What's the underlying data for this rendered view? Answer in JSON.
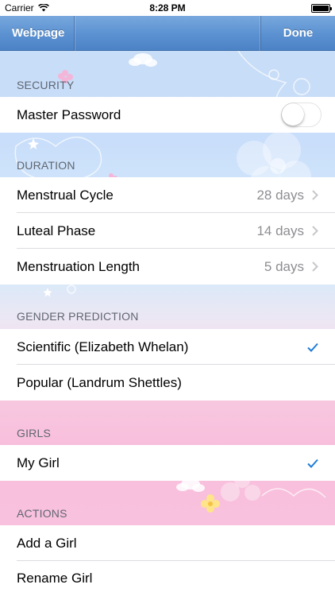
{
  "status_bar": {
    "carrier": "Carrier",
    "time": "8:28 PM"
  },
  "nav": {
    "left_label": "Webpage",
    "right_label": "Done"
  },
  "sections": {
    "security": {
      "header": "SECURITY",
      "items": [
        {
          "label": "Master Password",
          "toggle_on": false
        }
      ]
    },
    "duration": {
      "header": "DURATION",
      "items": [
        {
          "label": "Menstrual Cycle",
          "value": "28 days"
        },
        {
          "label": "Luteal Phase",
          "value": "14 days"
        },
        {
          "label": "Menstruation Length",
          "value": "5 days"
        }
      ]
    },
    "gender_prediction": {
      "header": "GENDER PREDICTION",
      "items": [
        {
          "label": "Scientific (Elizabeth Whelan)",
          "checked": true
        },
        {
          "label": "Popular (Landrum Shettles)",
          "checked": false
        }
      ]
    },
    "girls": {
      "header": "GIRLS",
      "items": [
        {
          "label": "My Girl",
          "checked": true
        }
      ]
    },
    "actions": {
      "header": "ACTIONS",
      "items": [
        {
          "label": "Add a Girl"
        },
        {
          "label": "Rename Girl"
        }
      ]
    }
  },
  "colors": {
    "nav_blue": "#5b91d1",
    "check_blue": "#1f7cd8",
    "chevron_gray": "#c7c7cc"
  }
}
